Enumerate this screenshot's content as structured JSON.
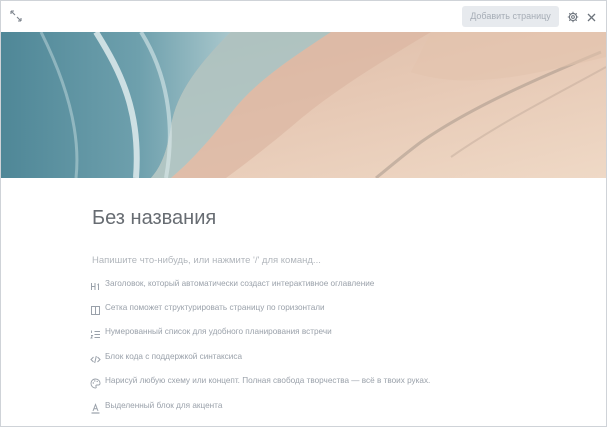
{
  "topbar": {
    "add_page_label": "Добавить страницу",
    "expand_icon": "expand-icon",
    "settings_icon": "gear-icon",
    "close_icon": "close-icon"
  },
  "page": {
    "title": "Без названия",
    "placeholder": "Напишите что-нибудь, или нажмите '/' для команд..."
  },
  "suggestions": [
    {
      "icon": "heading-icon",
      "text": "Заголовок, который автоматически создаст интерактивное оглавление"
    },
    {
      "icon": "columns-icon",
      "text": "Сетка поможет структурировать страницу по горизонтали"
    },
    {
      "icon": "numbered-list-icon",
      "text": "Нумерованный список для удобного планирования встречи"
    },
    {
      "icon": "code-icon",
      "text": "Блок кода с поддержкой синтаксиса"
    },
    {
      "icon": "palette-icon",
      "text": "Нарисуй любую схему или концепт. Полная свобода творчества — всё в твоих руках."
    },
    {
      "icon": "highlight-icon",
      "text": "Выделенный блок для акцента"
    }
  ],
  "colors": {
    "sea": "#5d93a3",
    "foam": "#d9e7ea",
    "sand": "#e8cbb8",
    "text_muted": "#9aa1aa"
  }
}
